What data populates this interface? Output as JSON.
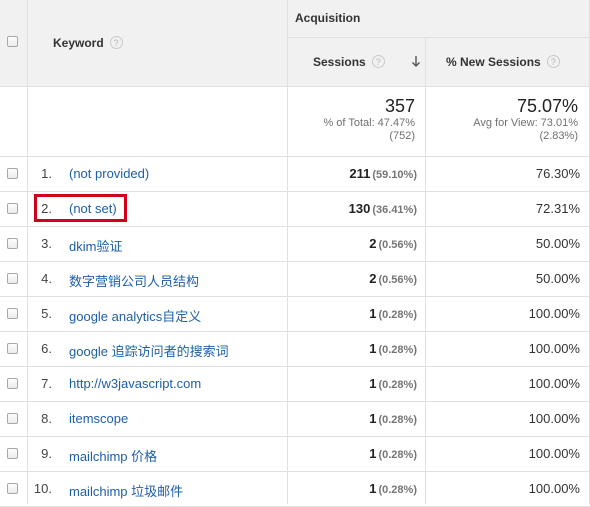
{
  "header": {
    "keyword_label": "Keyword",
    "help_glyph": "?",
    "group_label": "Acquisition",
    "sessions_label": "Sessions",
    "new_sessions_label": "% New Sessions"
  },
  "totals": {
    "sessions_value": "357",
    "sessions_note_1": "% of Total: 47.47%",
    "sessions_note_2": "(752)",
    "new_sessions_value": "75.07%",
    "new_sessions_note_1": "Avg for View: 73.01%",
    "new_sessions_note_2": "(2.83%)"
  },
  "rows": [
    {
      "index": "1.",
      "keyword": "(not provided)",
      "sessions": "211",
      "sessions_pct": "(59.10%)",
      "new_sessions": "76.30%"
    },
    {
      "index": "2.",
      "keyword": "(not set)",
      "sessions": "130",
      "sessions_pct": "(36.41%)",
      "new_sessions": "72.31%"
    },
    {
      "index": "3.",
      "keyword": "dkim验证",
      "sessions": "2",
      "sessions_pct": "(0.56%)",
      "new_sessions": "50.00%"
    },
    {
      "index": "4.",
      "keyword": "数字营销公司人员结构",
      "sessions": "2",
      "sessions_pct": "(0.56%)",
      "new_sessions": "50.00%"
    },
    {
      "index": "5.",
      "keyword": "google analytics自定义",
      "sessions": "1",
      "sessions_pct": "(0.28%)",
      "new_sessions": "100.00%"
    },
    {
      "index": "6.",
      "keyword": "google 追踪访问者的搜索词",
      "sessions": "1",
      "sessions_pct": "(0.28%)",
      "new_sessions": "100.00%"
    },
    {
      "index": "7.",
      "keyword": "http://w3javascript.com",
      "sessions": "1",
      "sessions_pct": "(0.28%)",
      "new_sessions": "100.00%"
    },
    {
      "index": "8.",
      "keyword": "itemscope",
      "sessions": "1",
      "sessions_pct": "(0.28%)",
      "new_sessions": "100.00%"
    },
    {
      "index": "9.",
      "keyword": "mailchimp 价格",
      "sessions": "1",
      "sessions_pct": "(0.28%)",
      "new_sessions": "100.00%"
    },
    {
      "index": "10.",
      "keyword": "mailchimp 垃圾邮件",
      "sessions": "1",
      "sessions_pct": "(0.28%)",
      "new_sessions": "100.00%"
    }
  ],
  "highlight": {
    "row_index": 1,
    "color": "#d0021b"
  },
  "colors": {
    "link": "#1f5ea8",
    "header_bg": "#f1f1f1",
    "grid_line": "#e0e0e0"
  }
}
